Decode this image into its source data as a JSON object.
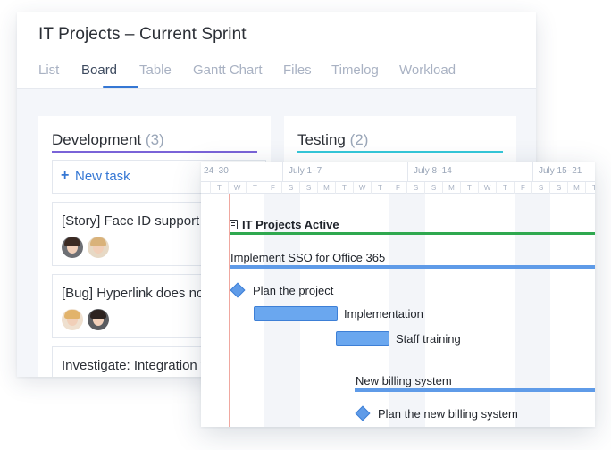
{
  "board": {
    "title": "IT Projects – Current Sprint",
    "tabs": [
      "List",
      "Board",
      "Table",
      "Gantt Chart",
      "Files",
      "Timelog",
      "Workload"
    ],
    "active_tab": "Board",
    "columns": [
      {
        "name": "Development",
        "count": "(3)",
        "accent": "#7a63d8",
        "new_task_label": "New task",
        "tasks": [
          {
            "text": "[Story] Face ID support o"
          },
          {
            "text": "[Bug] Hyperlink does no"
          },
          {
            "text": "Investigate: Integration w"
          }
        ]
      },
      {
        "name": "Testing",
        "count": "(2)",
        "accent": "#35c7d9"
      }
    ]
  },
  "gantt": {
    "weeks": [
      "24–30",
      "July 1–7",
      "July 8–14",
      "July 15–21"
    ],
    "day_letters": [
      "T",
      "W",
      "T",
      "F",
      "S",
      "S",
      "M",
      "T",
      "W",
      "T",
      "F",
      "S",
      "S",
      "M",
      "T",
      "W",
      "T",
      "F",
      "S",
      "S",
      "M",
      "T"
    ],
    "project": "IT Projects Active",
    "rows": [
      {
        "label": "Implement SSO for Office 365"
      },
      {
        "label": "Plan the project"
      },
      {
        "label": "Implementation"
      },
      {
        "label": "Staff training"
      },
      {
        "label": "New billing system"
      },
      {
        "label": "Plan the new billing system"
      }
    ]
  }
}
